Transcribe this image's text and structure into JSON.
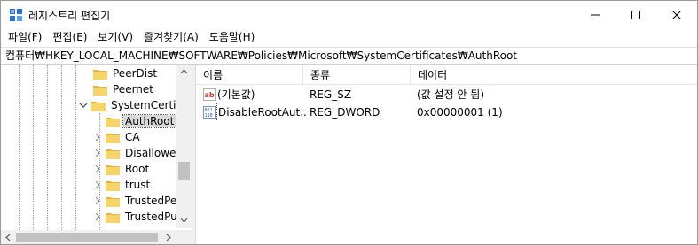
{
  "window": {
    "title": "레지스트리 편집기",
    "minimize_glyph": "—",
    "maximize_glyph": "☐",
    "close_glyph": "✕"
  },
  "menu": {
    "items": [
      {
        "label": "파일(F)"
      },
      {
        "label": "편집(E)"
      },
      {
        "label": "보기(V)"
      },
      {
        "label": "즐겨찾기(A)"
      },
      {
        "label": "도움말(H)"
      }
    ]
  },
  "address": {
    "path": "컴퓨터₩HKEY_LOCAL_MACHINE₩SOFTWARE₩Policies₩Microsoft₩SystemCertificates₩AuthRoot"
  },
  "tree": {
    "items": [
      {
        "label": "PeerDist",
        "level": 1,
        "expander": "none"
      },
      {
        "label": "Peernet",
        "level": 1,
        "expander": "none"
      },
      {
        "label": "SystemCertific",
        "level": 1,
        "expander": "expanded"
      },
      {
        "label": "AuthRoot",
        "level": 2,
        "expander": "none",
        "selected": true
      },
      {
        "label": "CA",
        "level": 2,
        "expander": "collapsed"
      },
      {
        "label": "Disallowed",
        "level": 2,
        "expander": "collapsed"
      },
      {
        "label": "Root",
        "level": 2,
        "expander": "collapsed"
      },
      {
        "label": "trust",
        "level": 2,
        "expander": "collapsed"
      },
      {
        "label": "TrustedPeo",
        "level": 2,
        "expander": "collapsed"
      },
      {
        "label": "TrustedPub",
        "level": 2,
        "expander": "collapsed"
      }
    ]
  },
  "list": {
    "columns": {
      "name": "이름",
      "type": "종류",
      "data": "데이터"
    },
    "rows": [
      {
        "icon": "string-value-icon",
        "name": "(기본값)",
        "type": "REG_SZ",
        "data": "(값 설정 안 됨)"
      },
      {
        "icon": "binary-value-icon",
        "name": "DisableRootAut...",
        "type": "REG_DWORD",
        "data": "0x00000001 (1)",
        "selected": true
      }
    ]
  },
  "colors": {
    "folder": "#f5d46b",
    "folder_dark": "#e2b440",
    "selection": "#d9d9d9",
    "scrollbar_track": "#f0f0f0",
    "scrollbar_thumb": "#c1c1c1"
  }
}
